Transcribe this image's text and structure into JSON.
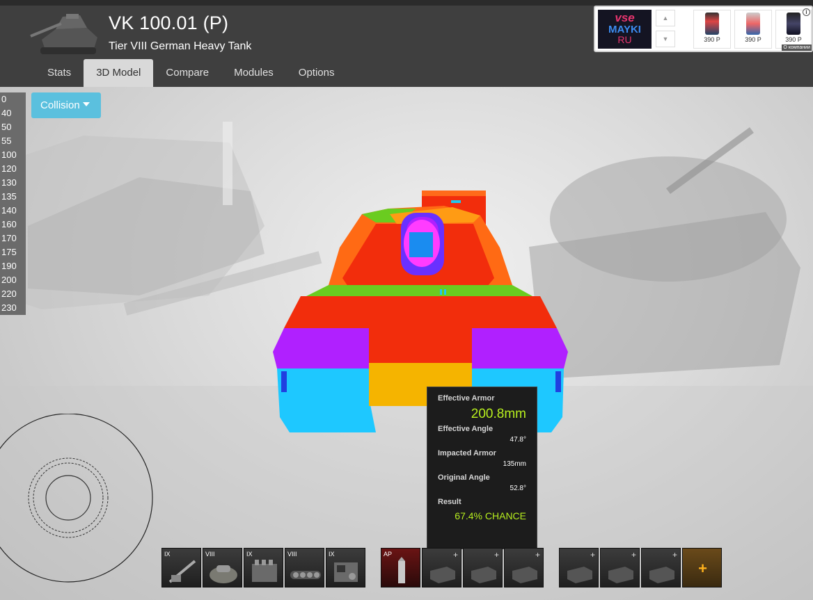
{
  "header": {
    "tank_name": "VK 100.01 (P)",
    "tank_subtitle": "Tier VIII German Heavy Tank"
  },
  "tabs": [
    {
      "label": "Stats",
      "active": false
    },
    {
      "label": "3D Model",
      "active": true
    },
    {
      "label": "Compare",
      "active": false
    },
    {
      "label": "Modules",
      "active": false
    },
    {
      "label": "Options",
      "active": false
    }
  ],
  "ad": {
    "logo_line1": "vse",
    "logo_line2": "MAYKI",
    "logo_line3": "RU",
    "items": [
      {
        "price": "390 Р"
      },
      {
        "price": "390 Р"
      },
      {
        "price": "390 Р"
      }
    ],
    "about": "О компании"
  },
  "armor_scale": [
    "0",
    "40",
    "50",
    "55",
    "100",
    "120",
    "130",
    "135",
    "140",
    "160",
    "170",
    "175",
    "190",
    "200",
    "220",
    "230"
  ],
  "collision": {
    "label": "Collision"
  },
  "tooltip": {
    "effective_armor_label": "Effective Armor",
    "effective_armor_value": "200.8mm",
    "effective_angle_label": "Effective Angle",
    "effective_angle_value": "47.8°",
    "impacted_armor_label": "Impacted Armor",
    "impacted_armor_value": "135mm",
    "original_angle_label": "Original Angle",
    "original_angle_value": "52.8°",
    "result_label": "Result",
    "result_value": "67.4% CHANCE"
  },
  "modules": [
    {
      "tier": "IX",
      "icon": "gun-icon"
    },
    {
      "tier": "VIII",
      "icon": "turret-icon"
    },
    {
      "tier": "IX",
      "icon": "engine-icon"
    },
    {
      "tier": "VIII",
      "icon": "suspension-icon"
    },
    {
      "tier": "IX",
      "icon": "radio-icon"
    }
  ],
  "ammo": [
    {
      "tier": "AP",
      "icon": "shell-icon"
    }
  ],
  "colors": {
    "accent": "#5bc0de",
    "highlight": "#b8f01e",
    "header_bg": "#3f3f3f"
  }
}
